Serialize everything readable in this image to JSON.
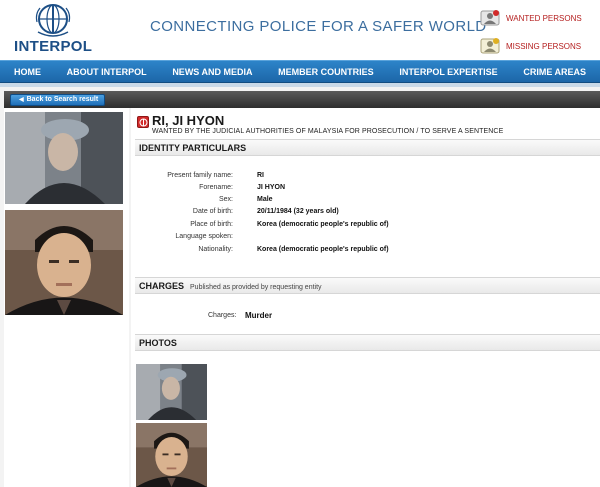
{
  "header": {
    "logo_text": "INTERPOL",
    "tagline": "CONNECTING POLICE FOR A SAFER WORLD",
    "quick_links": [
      {
        "label": "WANTED PERSONS",
        "icon": "wanted-persons-icon"
      },
      {
        "label": "MISSING PERSONS",
        "icon": "missing-persons-icon"
      }
    ]
  },
  "nav": {
    "items": [
      "HOME",
      "ABOUT INTERPOL",
      "NEWS AND MEDIA",
      "MEMBER COUNTRIES",
      "INTERPOL EXPERTISE",
      "CRIME AREAS"
    ]
  },
  "back_button": "Back to Search result",
  "notice": {
    "name": "RI, JI HYON",
    "wanted_by": "WANTED BY THE JUDICIAL AUTHORITIES OF MALAYSIA FOR PROSECUTION / TO SERVE A SENTENCE"
  },
  "identity": {
    "title": "IDENTITY PARTICULARS",
    "rows": [
      {
        "label": "Present family name:",
        "value": "RI"
      },
      {
        "label": "Forename:",
        "value": "JI HYON"
      },
      {
        "label": "Sex:",
        "value": "Male"
      },
      {
        "label": "Date of birth:",
        "value": "20/11/1984 (32 years old)"
      },
      {
        "label": "Place of birth:",
        "value": "Korea (democratic people's republic of)"
      },
      {
        "label": "Language spoken:",
        "value": ""
      },
      {
        "label": "Nationality:",
        "value": "Korea (democratic people's republic of)"
      }
    ]
  },
  "charges": {
    "title": "CHARGES",
    "note": "Published as provided by requesting entity",
    "label": "Charges:",
    "value": "Murder"
  },
  "photos": {
    "title": "PHOTOS"
  },
  "colors": {
    "brand_blue": "#1d4f86",
    "nav_blue": "#1c66a8",
    "alert_red": "#d22a2a"
  }
}
